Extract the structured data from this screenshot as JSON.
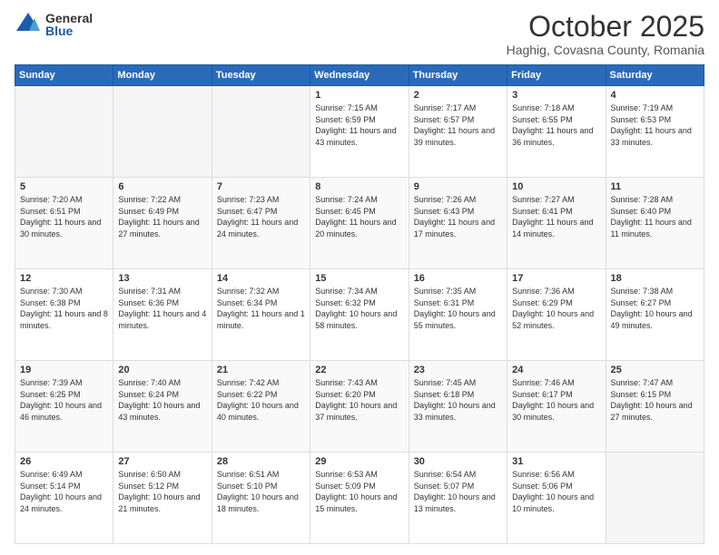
{
  "logo": {
    "general": "General",
    "blue": "Blue"
  },
  "title": "October 2025",
  "location": "Haghig, Covasna County, Romania",
  "days_header": [
    "Sunday",
    "Monday",
    "Tuesday",
    "Wednesday",
    "Thursday",
    "Friday",
    "Saturday"
  ],
  "weeks": [
    [
      {
        "day": "",
        "sunrise": "",
        "sunset": "",
        "daylight": ""
      },
      {
        "day": "",
        "sunrise": "",
        "sunset": "",
        "daylight": ""
      },
      {
        "day": "",
        "sunrise": "",
        "sunset": "",
        "daylight": ""
      },
      {
        "day": "1",
        "sunrise": "Sunrise: 7:15 AM",
        "sunset": "Sunset: 6:59 PM",
        "daylight": "Daylight: 11 hours and 43 minutes."
      },
      {
        "day": "2",
        "sunrise": "Sunrise: 7:17 AM",
        "sunset": "Sunset: 6:57 PM",
        "daylight": "Daylight: 11 hours and 39 minutes."
      },
      {
        "day": "3",
        "sunrise": "Sunrise: 7:18 AM",
        "sunset": "Sunset: 6:55 PM",
        "daylight": "Daylight: 11 hours and 36 minutes."
      },
      {
        "day": "4",
        "sunrise": "Sunrise: 7:19 AM",
        "sunset": "Sunset: 6:53 PM",
        "daylight": "Daylight: 11 hours and 33 minutes."
      }
    ],
    [
      {
        "day": "5",
        "sunrise": "Sunrise: 7:20 AM",
        "sunset": "Sunset: 6:51 PM",
        "daylight": "Daylight: 11 hours and 30 minutes."
      },
      {
        "day": "6",
        "sunrise": "Sunrise: 7:22 AM",
        "sunset": "Sunset: 6:49 PM",
        "daylight": "Daylight: 11 hours and 27 minutes."
      },
      {
        "day": "7",
        "sunrise": "Sunrise: 7:23 AM",
        "sunset": "Sunset: 6:47 PM",
        "daylight": "Daylight: 11 hours and 24 minutes."
      },
      {
        "day": "8",
        "sunrise": "Sunrise: 7:24 AM",
        "sunset": "Sunset: 6:45 PM",
        "daylight": "Daylight: 11 hours and 20 minutes."
      },
      {
        "day": "9",
        "sunrise": "Sunrise: 7:26 AM",
        "sunset": "Sunset: 6:43 PM",
        "daylight": "Daylight: 11 hours and 17 minutes."
      },
      {
        "day": "10",
        "sunrise": "Sunrise: 7:27 AM",
        "sunset": "Sunset: 6:41 PM",
        "daylight": "Daylight: 11 hours and 14 minutes."
      },
      {
        "day": "11",
        "sunrise": "Sunrise: 7:28 AM",
        "sunset": "Sunset: 6:40 PM",
        "daylight": "Daylight: 11 hours and 11 minutes."
      }
    ],
    [
      {
        "day": "12",
        "sunrise": "Sunrise: 7:30 AM",
        "sunset": "Sunset: 6:38 PM",
        "daylight": "Daylight: 11 hours and 8 minutes."
      },
      {
        "day": "13",
        "sunrise": "Sunrise: 7:31 AM",
        "sunset": "Sunset: 6:36 PM",
        "daylight": "Daylight: 11 hours and 4 minutes."
      },
      {
        "day": "14",
        "sunrise": "Sunrise: 7:32 AM",
        "sunset": "Sunset: 6:34 PM",
        "daylight": "Daylight: 11 hours and 1 minute."
      },
      {
        "day": "15",
        "sunrise": "Sunrise: 7:34 AM",
        "sunset": "Sunset: 6:32 PM",
        "daylight": "Daylight: 10 hours and 58 minutes."
      },
      {
        "day": "16",
        "sunrise": "Sunrise: 7:35 AM",
        "sunset": "Sunset: 6:31 PM",
        "daylight": "Daylight: 10 hours and 55 minutes."
      },
      {
        "day": "17",
        "sunrise": "Sunrise: 7:36 AM",
        "sunset": "Sunset: 6:29 PM",
        "daylight": "Daylight: 10 hours and 52 minutes."
      },
      {
        "day": "18",
        "sunrise": "Sunrise: 7:38 AM",
        "sunset": "Sunset: 6:27 PM",
        "daylight": "Daylight: 10 hours and 49 minutes."
      }
    ],
    [
      {
        "day": "19",
        "sunrise": "Sunrise: 7:39 AM",
        "sunset": "Sunset: 6:25 PM",
        "daylight": "Daylight: 10 hours and 46 minutes."
      },
      {
        "day": "20",
        "sunrise": "Sunrise: 7:40 AM",
        "sunset": "Sunset: 6:24 PM",
        "daylight": "Daylight: 10 hours and 43 minutes."
      },
      {
        "day": "21",
        "sunrise": "Sunrise: 7:42 AM",
        "sunset": "Sunset: 6:22 PM",
        "daylight": "Daylight: 10 hours and 40 minutes."
      },
      {
        "day": "22",
        "sunrise": "Sunrise: 7:43 AM",
        "sunset": "Sunset: 6:20 PM",
        "daylight": "Daylight: 10 hours and 37 minutes."
      },
      {
        "day": "23",
        "sunrise": "Sunrise: 7:45 AM",
        "sunset": "Sunset: 6:18 PM",
        "daylight": "Daylight: 10 hours and 33 minutes."
      },
      {
        "day": "24",
        "sunrise": "Sunrise: 7:46 AM",
        "sunset": "Sunset: 6:17 PM",
        "daylight": "Daylight: 10 hours and 30 minutes."
      },
      {
        "day": "25",
        "sunrise": "Sunrise: 7:47 AM",
        "sunset": "Sunset: 6:15 PM",
        "daylight": "Daylight: 10 hours and 27 minutes."
      }
    ],
    [
      {
        "day": "26",
        "sunrise": "Sunrise: 6:49 AM",
        "sunset": "Sunset: 5:14 PM",
        "daylight": "Daylight: 10 hours and 24 minutes."
      },
      {
        "day": "27",
        "sunrise": "Sunrise: 6:50 AM",
        "sunset": "Sunset: 5:12 PM",
        "daylight": "Daylight: 10 hours and 21 minutes."
      },
      {
        "day": "28",
        "sunrise": "Sunrise: 6:51 AM",
        "sunset": "Sunset: 5:10 PM",
        "daylight": "Daylight: 10 hours and 18 minutes."
      },
      {
        "day": "29",
        "sunrise": "Sunrise: 6:53 AM",
        "sunset": "Sunset: 5:09 PM",
        "daylight": "Daylight: 10 hours and 15 minutes."
      },
      {
        "day": "30",
        "sunrise": "Sunrise: 6:54 AM",
        "sunset": "Sunset: 5:07 PM",
        "daylight": "Daylight: 10 hours and 13 minutes."
      },
      {
        "day": "31",
        "sunrise": "Sunrise: 6:56 AM",
        "sunset": "Sunset: 5:06 PM",
        "daylight": "Daylight: 10 hours and 10 minutes."
      },
      {
        "day": "",
        "sunrise": "",
        "sunset": "",
        "daylight": ""
      }
    ]
  ]
}
